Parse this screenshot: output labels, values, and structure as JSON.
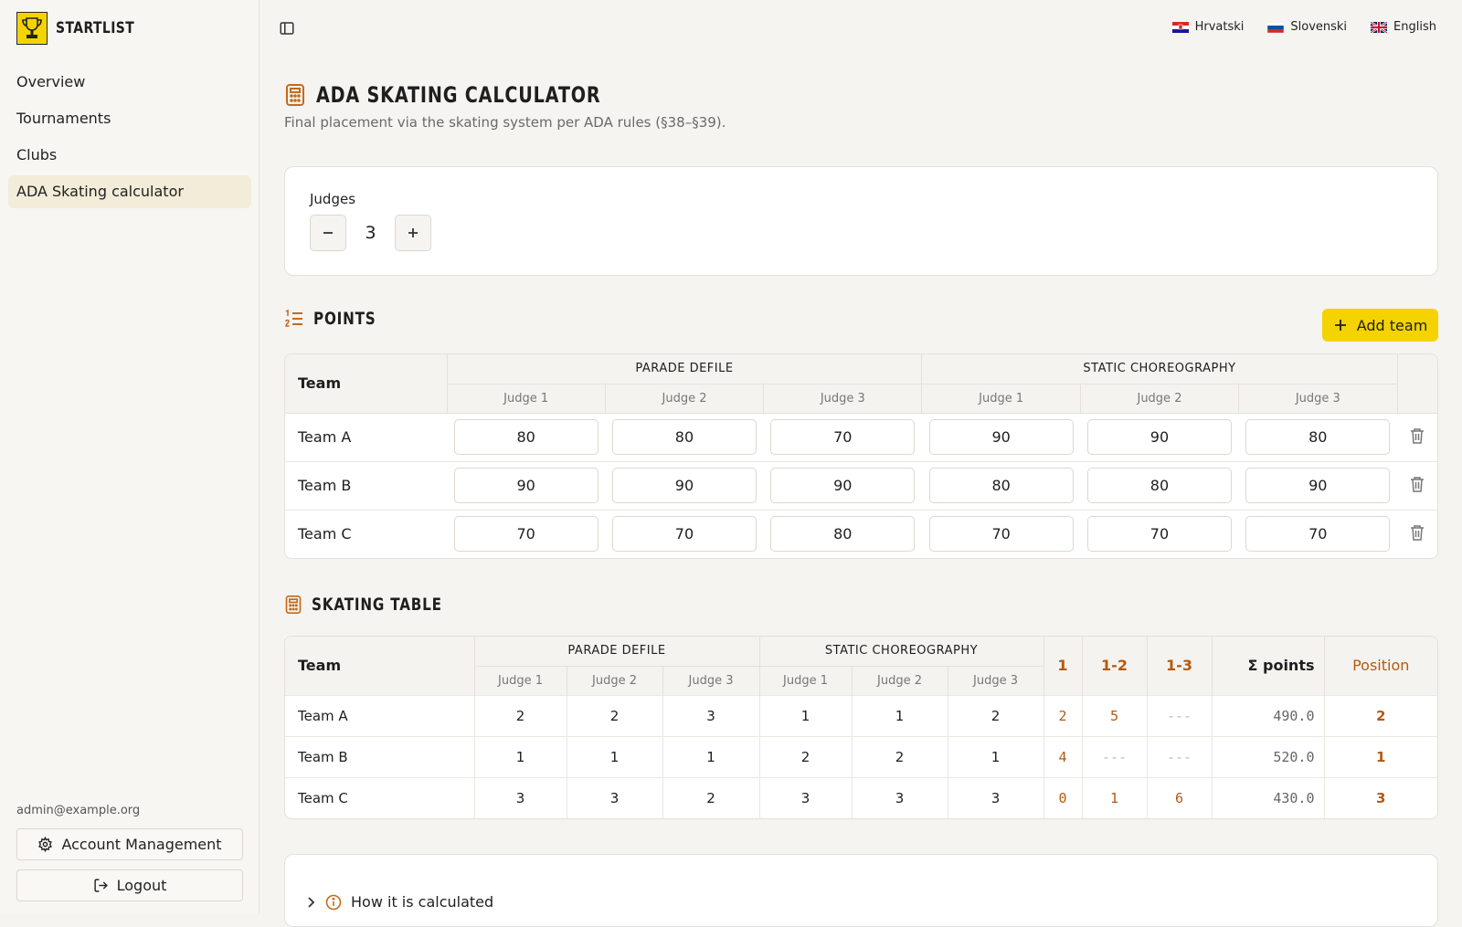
{
  "brand": {
    "name": "STARTLIST"
  },
  "nav": [
    {
      "label": "Overview"
    },
    {
      "label": "Tournaments"
    },
    {
      "label": "Clubs"
    },
    {
      "label": "ADA Skating calculator",
      "active": true
    }
  ],
  "user": {
    "email": "admin@example.org"
  },
  "sidebar_buttons": {
    "account": "Account Management",
    "logout": "Logout"
  },
  "languages": [
    {
      "label": "Hrvatski",
      "flag": "hr"
    },
    {
      "label": "Slovenski",
      "flag": "si"
    },
    {
      "label": "English",
      "flag": "gb"
    }
  ],
  "page": {
    "title": "ADA SKATING CALCULATOR",
    "subtitle": "Final placement via the skating system per ADA rules (§38–§39)."
  },
  "judges": {
    "label": "Judges",
    "count": "3"
  },
  "points": {
    "title": "POINTS",
    "add_button": "Add team",
    "team_header": "Team",
    "groups": [
      "PARADE DEFILE",
      "STATIC CHOREOGRAPHY"
    ],
    "judges": [
      "Judge 1",
      "Judge 2",
      "Judge 3"
    ],
    "rows": [
      {
        "team": "Team A",
        "values": [
          "80",
          "80",
          "70",
          "90",
          "90",
          "80"
        ]
      },
      {
        "team": "Team B",
        "values": [
          "90",
          "90",
          "90",
          "80",
          "80",
          "90"
        ]
      },
      {
        "team": "Team C",
        "values": [
          "70",
          "70",
          "80",
          "70",
          "70",
          "70"
        ]
      }
    ]
  },
  "skating": {
    "title": "SKATING TABLE",
    "team_header": "Team",
    "groups": [
      "PARADE DEFILE",
      "STATIC CHOREOGRAPHY"
    ],
    "judges": [
      "Judge 1",
      "Judge 2",
      "Judge 3"
    ],
    "majority_headers": [
      "1",
      "1-2",
      "1-3"
    ],
    "sum_header": "Σ points",
    "position_header": "Position",
    "rows": [
      {
        "team": "Team A",
        "ranks": [
          "2",
          "2",
          "3",
          "1",
          "1",
          "2"
        ],
        "majority": [
          "2",
          "5",
          "---"
        ],
        "sum": "490.0",
        "position": "2"
      },
      {
        "team": "Team B",
        "ranks": [
          "1",
          "1",
          "1",
          "2",
          "2",
          "1"
        ],
        "majority": [
          "4",
          "---",
          "---"
        ],
        "sum": "520.0",
        "position": "1"
      },
      {
        "team": "Team C",
        "ranks": [
          "3",
          "3",
          "2",
          "3",
          "3",
          "3"
        ],
        "majority": [
          "0",
          "1",
          "6"
        ],
        "sum": "430.0",
        "position": "3"
      }
    ]
  },
  "how": {
    "label": "How it is calculated"
  },
  "colors": {
    "accent": "#f5d300",
    "highlight": "#b35a12",
    "active_nav": "#f2ecd9"
  }
}
